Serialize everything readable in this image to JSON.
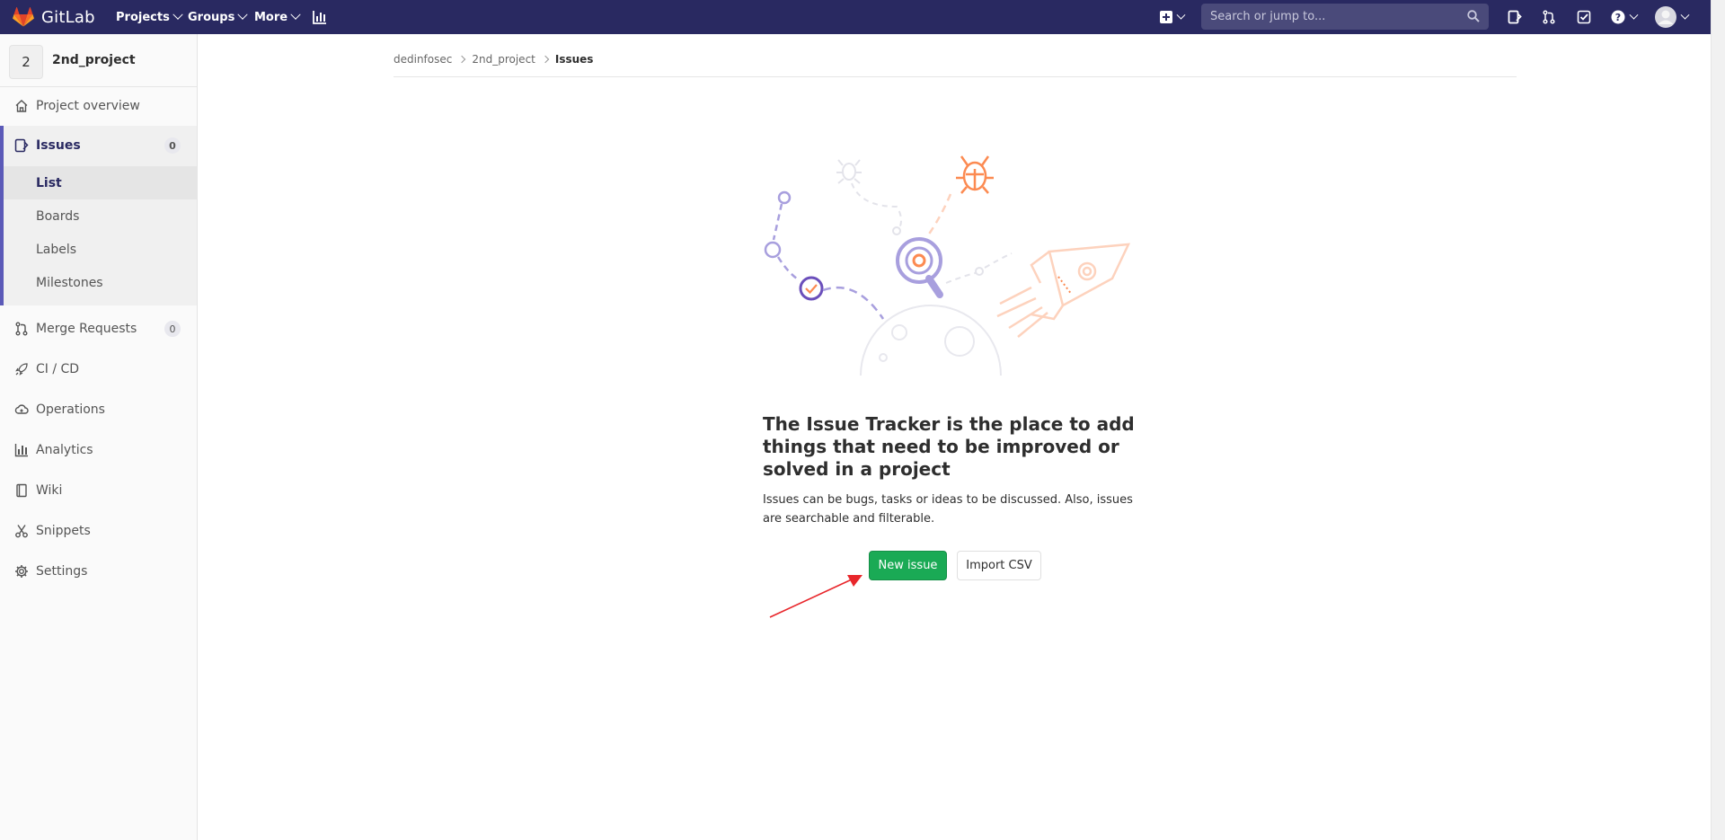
{
  "topbar": {
    "brand": "GitLab",
    "nav": [
      {
        "label": "Projects"
      },
      {
        "label": "Groups"
      },
      {
        "label": "More"
      }
    ],
    "search_placeholder": "Search or jump to...",
    "icons": [
      "activity-chart-icon",
      "plus-square-icon",
      "search-icon",
      "issues-icon",
      "merge-request-icon",
      "todo-icon",
      "help-icon",
      "user-avatar-icon"
    ]
  },
  "sidebar": {
    "project_initial": "2",
    "project_name": "2nd_project",
    "items": [
      {
        "label": "Project overview",
        "icon": "home-icon"
      },
      {
        "label": "Issues",
        "icon": "issues-icon",
        "count": "0"
      },
      {
        "label": "Merge Requests",
        "icon": "merge-request-icon",
        "count": "0"
      },
      {
        "label": "CI / CD",
        "icon": "rocket-icon"
      },
      {
        "label": "Operations",
        "icon": "cloud-icon"
      },
      {
        "label": "Analytics",
        "icon": "chart-icon"
      },
      {
        "label": "Wiki",
        "icon": "book-icon"
      },
      {
        "label": "Snippets",
        "icon": "scissors-icon"
      },
      {
        "label": "Settings",
        "icon": "gear-icon"
      }
    ],
    "issues_sub": [
      {
        "label": "List",
        "active": true
      },
      {
        "label": "Boards"
      },
      {
        "label": "Labels"
      },
      {
        "label": "Milestones"
      }
    ]
  },
  "breadcrumbs": [
    "dedinfosec",
    "2nd_project",
    "Issues"
  ],
  "empty_state": {
    "title": "The Issue Tracker is the place to add things that need to be improved or solved in a project",
    "description": "Issues can be bugs, tasks or ideas to be discussed. Also, issues are searchable and filterable.",
    "new_issue_label": "New issue",
    "import_csv_label": "Import CSV"
  },
  "colors": {
    "navbar": "#292961",
    "primary_green": "#1aaa55",
    "active_accent": "#5b5ab8",
    "annotation_arrow": "#e8262b"
  }
}
